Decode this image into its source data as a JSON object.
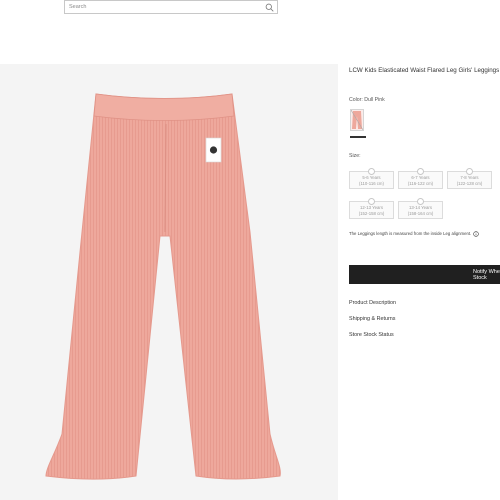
{
  "search": {
    "placeholder": "Search"
  },
  "product": {
    "title": "LCW Kids Elasticated Waist Flared Leg Girls' Leggings",
    "color_label": "Color: Dull Pink",
    "size_label": "Size:",
    "sizes": [
      {
        "label": "5-6 Years",
        "sub": "(110-116 cm)"
      },
      {
        "label": "6-7 Years",
        "sub": "(116-122 cm)"
      },
      {
        "label": "7-8 Years",
        "sub": "(122-128 cm)"
      },
      {
        "label": "12-13 Years",
        "sub": "(152-158 cm)"
      },
      {
        "label": "13-14 Years",
        "sub": "(158-164 cm)"
      }
    ],
    "length_note": "The Leggings length is measured from the inside Leg alignment.",
    "notify_button": "Notify When In Stock",
    "links": [
      "Product Description",
      "Shipping & Returns",
      "Store Stock Status"
    ]
  },
  "colors": {
    "pants": "#eea89c",
    "notify_bg": "#202020",
    "image_bg": "#f4f4f4"
  },
  "icons": {
    "search": "search-icon",
    "bell": "bell-icon",
    "info": "info-icon"
  }
}
